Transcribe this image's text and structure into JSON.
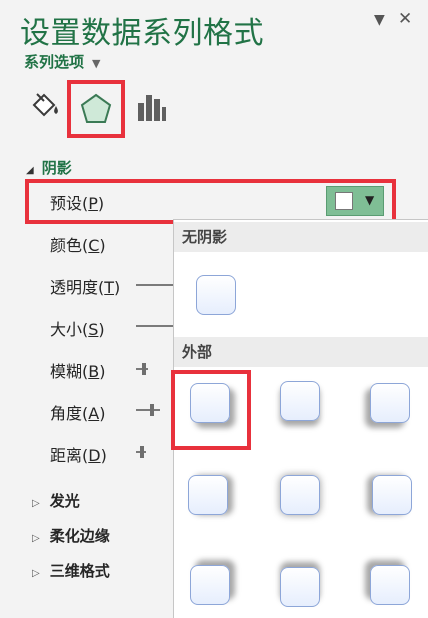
{
  "pane": {
    "title": "设置数据系列格式",
    "dropdown_caret": "▼",
    "close_symbol": "✕",
    "series_options_label": "系列选项",
    "series_options_caret": "▼"
  },
  "tabs": [
    {
      "name": "fill-line",
      "icon": "paint-bucket-icon",
      "selected": false
    },
    {
      "name": "effects",
      "icon": "pentagon-icon",
      "selected": true
    },
    {
      "name": "series-options",
      "icon": "bar-chart-icon",
      "selected": false
    }
  ],
  "shadow_section": {
    "collapse_glyph": "◢",
    "title": "阴影",
    "preset": {
      "label": "预设(",
      "key": "P",
      "suffix": ")",
      "dropdown_arrow": "▼"
    },
    "color": {
      "label": "颜色(",
      "key": "C",
      "suffix": ")"
    },
    "transparency": {
      "label": "透明度(",
      "key": "T",
      "suffix": ")"
    },
    "size": {
      "label": "大小(",
      "key": "S",
      "suffix": ")"
    },
    "blur": {
      "label": "模糊(",
      "key": "B",
      "suffix": ")"
    },
    "angle": {
      "label": "角度(",
      "key": "A",
      "suffix": ")"
    },
    "distance": {
      "label": "距离(",
      "key": "D",
      "suffix": ")"
    }
  },
  "collapsed_sections": [
    {
      "glyph": "▷",
      "label": "发光"
    },
    {
      "glyph": "▷",
      "label": "柔化边缘"
    },
    {
      "glyph": "▷",
      "label": "三维格式"
    }
  ],
  "gallery": {
    "no_shadow_heading": "无阴影",
    "outer_heading": "外部",
    "outer_presets": 9,
    "highlighted_preset": "outer-1"
  },
  "colors": {
    "accent_green": "#217346",
    "highlight_red": "#e8313c",
    "preset_button": "#7fbe95"
  }
}
